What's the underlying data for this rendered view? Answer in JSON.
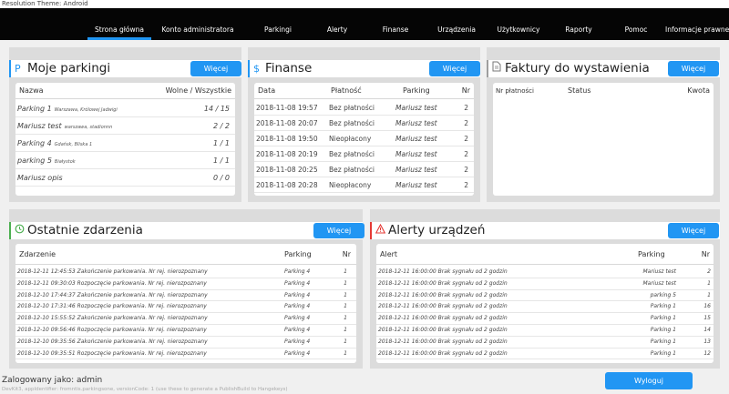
{
  "topstrip": "Resolution Theme: Android",
  "nav": {
    "items": [
      {
        "label": "Strona główna",
        "active": true
      },
      {
        "label": "Konto administratora"
      },
      {
        "label": "Parkingi"
      },
      {
        "label": "Alerty"
      },
      {
        "label": "Finanse"
      },
      {
        "label": "Urządzenia"
      },
      {
        "label": "Użytkownicy"
      },
      {
        "label": "Raporty"
      },
      {
        "label": "Pomoc"
      },
      {
        "label": "Informacje prawne"
      }
    ]
  },
  "colors": {
    "accent": "#2196f3",
    "navbar": "#050505",
    "panel": "#dcdcdc",
    "alert": "#e53935",
    "green": "#4caf50"
  },
  "parkings": {
    "title": "Moje parkingi",
    "icon": "P",
    "button": "Więcej",
    "headers": [
      "Nazwa",
      "Wolne / Wszystkie"
    ],
    "rows": [
      {
        "name": "Parking 1",
        "addr": "Warszawa, Królowej Jadwigi",
        "count": "14 / 15"
      },
      {
        "name": "Mariusz test",
        "addr": "warszawa, stadionnn",
        "count": "2 / 2"
      },
      {
        "name": "Parking 4",
        "addr": "Gdańsk, Bliska 1",
        "count": "1 / 1"
      },
      {
        "name": "parking 5",
        "addr": "Białystok",
        "count": "1 / 1"
      },
      {
        "name": "Mariusz opis",
        "addr": "",
        "count": "0 / 0"
      }
    ]
  },
  "finance": {
    "title": "Finanse",
    "icon": "$",
    "button": "Więcej",
    "headers": [
      "Data",
      "Płatność",
      "Parking",
      "Nr"
    ],
    "rows": [
      {
        "date": "2018-11-08 19:57",
        "pay": "Bez płatności",
        "parking": "Mariusz test",
        "nr": "2"
      },
      {
        "date": "2018-11-08 20:07",
        "pay": "Bez płatności",
        "parking": "Mariusz test",
        "nr": "2"
      },
      {
        "date": "2018-11-08 19:50",
        "pay": "Nieopłacony",
        "parking": "Mariusz test",
        "nr": "2"
      },
      {
        "date": "2018-11-08 20:19",
        "pay": "Bez płatności",
        "parking": "Mariusz test",
        "nr": "2"
      },
      {
        "date": "2018-11-08 20:25",
        "pay": "Bez płatności",
        "parking": "Mariusz test",
        "nr": "2"
      },
      {
        "date": "2018-11-08 20:28",
        "pay": "Nieopłacony",
        "parking": "Mariusz test",
        "nr": "2"
      }
    ]
  },
  "invoices": {
    "title": "Faktury do wystawienia",
    "icon": "document",
    "button": "Więcej",
    "headers": [
      "Nr płatności",
      "Status",
      "Kwota"
    ]
  },
  "events": {
    "title": "Ostatnie zdarzenia",
    "icon": "clock",
    "button": "Więcej",
    "headers": [
      "Zdarzenie",
      "Parking",
      "Nr"
    ],
    "rows": [
      {
        "text": "2018-12-11 12:45:53  Zakończenie parkowania. Nr rej. nierozpoznany",
        "parking": "Parking 4",
        "nr": "1"
      },
      {
        "text": "2018-12-11 09:30:03  Rozpoczęcie parkowania. Nr rej. nierozpoznany",
        "parking": "Parking 4",
        "nr": "1"
      },
      {
        "text": "2018-12-10 17:44:37  Zakończenie parkowania. Nr rej. nierozpoznany",
        "parking": "Parking 4",
        "nr": "1"
      },
      {
        "text": "2018-12-10 17:31:46  Rozpoczęcie parkowania. Nr rej. nierozpoznany",
        "parking": "Parking 4",
        "nr": "1"
      },
      {
        "text": "2018-12-10 15:55:52  Zakończenie parkowania. Nr rej. nierozpoznany",
        "parking": "Parking 4",
        "nr": "1"
      },
      {
        "text": "2018-12-10 09:56:46  Rozpoczęcie parkowania. Nr rej. nierozpoznany",
        "parking": "Parking 4",
        "nr": "1"
      },
      {
        "text": "2018-12-10 09:35:56  Zakończenie parkowania. Nr rej. nierozpoznany",
        "parking": "Parking 4",
        "nr": "1"
      },
      {
        "text": "2018-12-10 09:35:51  Rozpoczęcie parkowania. Nr rej. nierozpoznany",
        "parking": "Parking 4",
        "nr": "1"
      }
    ]
  },
  "alerts": {
    "title": "Alerty urządzeń",
    "icon": "warning",
    "button": "Więcej",
    "headers": [
      "Alert",
      "Parking",
      "Nr"
    ],
    "rows": [
      {
        "text": "2018-12-11 16:00:00  Brak sygnału od 2 godzin",
        "parking": "Mariusz test",
        "nr": "2"
      },
      {
        "text": "2018-12-11 16:00:00  Brak sygnału od 2 godzin",
        "parking": "Mariusz test",
        "nr": "1"
      },
      {
        "text": "2018-12-11 16:00:00  Brak sygnału od 2 godzin",
        "parking": "parking 5",
        "nr": "1"
      },
      {
        "text": "2018-12-11 16:00:00  Brak sygnału od 2 godzin",
        "parking": "Parking 1",
        "nr": "16"
      },
      {
        "text": "2018-12-11 16:00:00  Brak sygnału od 2 godzin",
        "parking": "Parking 1",
        "nr": "15"
      },
      {
        "text": "2018-12-11 16:00:00  Brak sygnału od 2 godzin",
        "parking": "Parking 1",
        "nr": "14"
      },
      {
        "text": "2018-12-11 16:00:00  Brak sygnału od 2 godzin",
        "parking": "Parking 1",
        "nr": "13"
      },
      {
        "text": "2018-12-11 16:00:00  Brak sygnału od 2 godzin",
        "parking": "Parking 1",
        "nr": "12"
      }
    ]
  },
  "footer": {
    "user": "Zalogowany jako: admin",
    "info": "DevKit3, appIdentifier: fromntis.parkingsone, versionCode: 1 (use these to generate a PublishBuild to Hangekeys)",
    "logout": "Wyloguj"
  }
}
